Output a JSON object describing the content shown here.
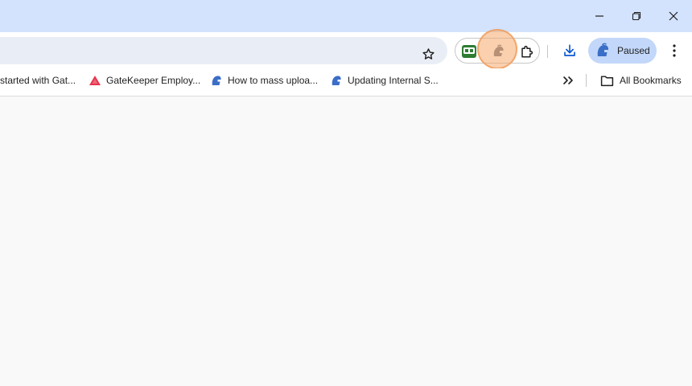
{
  "window_controls": {
    "minimize": "minimize-icon",
    "restore": "restore-icon",
    "close": "close-icon"
  },
  "toolbar": {
    "bookmark_star_icon": "star-icon",
    "extensions": [
      "gatekeeper-green-extension-icon",
      "gatekeeper-spartan-extension-icon",
      "puzzle-extensions-icon"
    ],
    "download_icon": "download-icon",
    "profile_label": "Paused",
    "menu_icon": "three-dots-icon"
  },
  "bookmarks": {
    "items": [
      {
        "label": "started with Gat...",
        "icon": "none"
      },
      {
        "label": "GateKeeper Employ...",
        "icon": "red-triangle-icon"
      },
      {
        "label": "How to mass uploa...",
        "icon": "spartan-helmet-icon"
      },
      {
        "label": "Updating Internal S...",
        "icon": "spartan-helmet-icon"
      }
    ],
    "overflow_icon": "double-chevron-icon",
    "all_bookmarks_label": "All Bookmarks"
  },
  "colors": {
    "titlebar": "#d3e3fd",
    "omnibox": "#e9eef6",
    "profile_chip": "#c2d7f9",
    "highlight": "#f6aa6e",
    "content": "#f9f9f9"
  }
}
